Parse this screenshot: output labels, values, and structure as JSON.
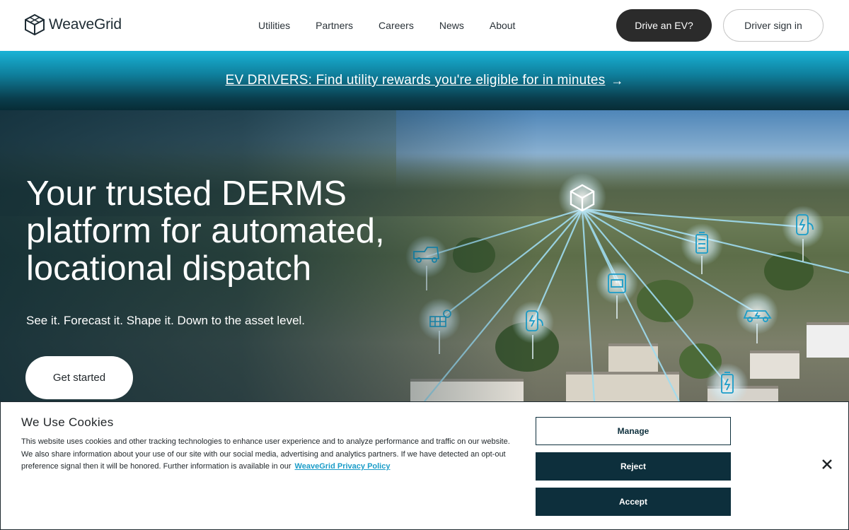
{
  "header": {
    "logo_text": "WeaveGrid",
    "nav": [
      "Utilities",
      "Partners",
      "Careers",
      "News",
      "About"
    ],
    "drive_label": "Drive an EV?",
    "signin_label": "Driver sign in"
  },
  "banner": {
    "text": "EV DRIVERS: Find utility rewards you're eligible for in minutes",
    "arrow": "→"
  },
  "hero": {
    "title": "Your trusted DERMS platform for automated, locational dispatch",
    "subtitle": "See it. Forecast it. Shape it. Down to the asset level.",
    "cta_label": "Get started",
    "network_icons": [
      "hub-icon",
      "ev-truck-icon",
      "solar-panel-icon",
      "ev-charger-icon",
      "thermostat-icon",
      "battery-icon",
      "ev-charger-icon",
      "electric-car-icon",
      "battery-charging-icon"
    ]
  },
  "cookie": {
    "title": "We Use Cookies",
    "body": "This website uses cookies and other tracking technologies to enhance user experience and to analyze performance and traffic on our website. We also share information about your use of our site with our social media, advertising and analytics partners. If we have detected an opt-out preference signal then it will be honored. Further information is available in our",
    "link_label": "WeaveGrid Privacy Policy",
    "manage_label": "Manage",
    "reject_label": "Reject",
    "accept_label": "Accept",
    "close_label": "✕"
  },
  "colors": {
    "primary_dark": "#0d2f3c",
    "drive_button": "#2b2b2b",
    "link_blue": "#1a9cc8",
    "network_glow": "#bfe8f5"
  }
}
